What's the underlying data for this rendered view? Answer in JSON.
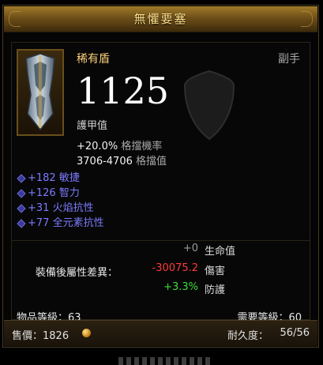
{
  "title": "無懼要塞",
  "item": {
    "type": "稀有盾",
    "slot": "副手",
    "armor_value": "1125",
    "armor_label": "護甲值",
    "block_chance": "+20.0%",
    "block_chance_label": "格擋機率",
    "block_amount": "3706-4706",
    "block_amount_label": "格擋值"
  },
  "affixes": [
    "+182 敏捷",
    "+126 智力",
    "+31 火焰抗性",
    "+77 全元素抗性"
  ],
  "comparison": {
    "title": "裝備後屬性差異：",
    "rows": [
      {
        "value": "+0",
        "label": "生命值",
        "color": "#9a9a9a"
      },
      {
        "value": "-30075.2",
        "label": "傷害",
        "color": "#ff3a3a"
      },
      {
        "value": "+3.3%",
        "label": "防護",
        "color": "#3ddc3d"
      }
    ]
  },
  "levels": {
    "item_level": "物品等級：63",
    "required_level": "需要等級：60"
  },
  "footer": {
    "sell_price": "售價：1826",
    "durability_label": "耐久度：",
    "durability_value": "56/56"
  },
  "colors": {
    "title_text": "#ffe089",
    "rare_item": "#ffd17a",
    "magic_affix": "#7b7bff",
    "negative": "#ff3a3a",
    "positive": "#3ddc3d"
  },
  "icons": {
    "item": "shield-icon",
    "currency": "gold-coin-icon"
  }
}
